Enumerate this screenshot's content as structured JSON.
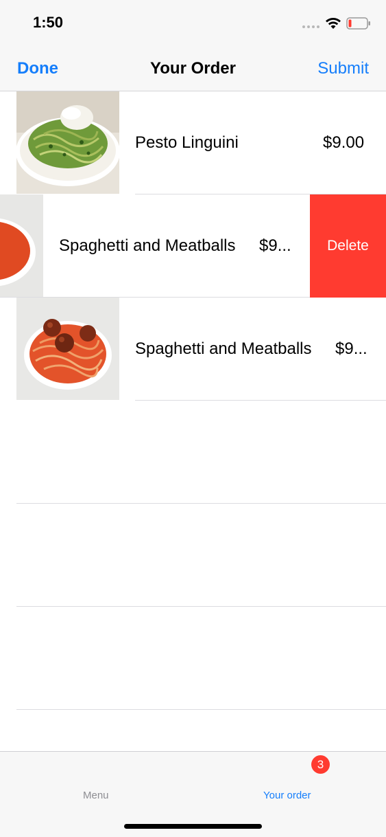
{
  "status_bar": {
    "time": "1:50",
    "icons": [
      "signal-dots-icon",
      "wifi-icon",
      "battery-low-icon"
    ],
    "battery_color": "#ff3b30"
  },
  "nav": {
    "left_label": "Done",
    "title": "Your Order",
    "right_label": "Submit"
  },
  "order_items": [
    {
      "name": "Pesto Linguini",
      "price": "$9.00",
      "thumbnail": "pesto-linguini-photo"
    },
    {
      "name": "Spaghetti and Meatballs",
      "price": "$9...",
      "thumbnail": "spaghetti-meatballs-photo",
      "swiped": true
    },
    {
      "name": "Spaghetti and Meatballs",
      "price": "$9...",
      "thumbnail": "spaghetti-meatballs-photo"
    }
  ],
  "swipe_action": {
    "label": "Delete",
    "color": "#ff3b30"
  },
  "tab_bar": {
    "tabs": [
      {
        "label": "Menu",
        "selected": false
      },
      {
        "label": "Your order",
        "selected": true,
        "badge": "3"
      }
    ]
  },
  "colors": {
    "accent": "#157efb",
    "destructive": "#ff3b30"
  }
}
